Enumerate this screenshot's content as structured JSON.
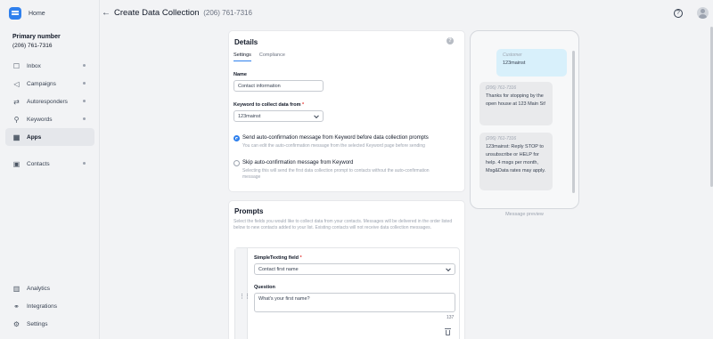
{
  "sidebar": {
    "home_label": "Home",
    "primary_title": "Primary number",
    "primary_number": "(206) 761-7316",
    "items": [
      {
        "label": "Inbox",
        "icon": "inbox-icon"
      },
      {
        "label": "Campaigns",
        "icon": "megaphone-icon"
      },
      {
        "label": "Autoresponders",
        "icon": "autoresponder-icon"
      },
      {
        "label": "Keywords",
        "icon": "key-icon"
      },
      {
        "label": "Apps",
        "icon": "apps-icon"
      },
      {
        "label": "Contacts",
        "icon": "contacts-icon"
      }
    ],
    "bottom": [
      {
        "label": "Analytics",
        "icon": "analytics-icon"
      },
      {
        "label": "Integrations",
        "icon": "integrations-icon"
      },
      {
        "label": "Settings",
        "icon": "gear-icon"
      }
    ]
  },
  "header": {
    "title": "Create Data Collection",
    "phone": "(206) 761-7316"
  },
  "details": {
    "title": "Details",
    "info": "?",
    "tabs": [
      "Settings",
      "Compliance"
    ],
    "name_label": "Name",
    "name_value": "Contact information",
    "keyword_label": "Keyword to collect data from",
    "keyword_value": "123mainst",
    "option1_title": "Send auto-confirmation message from Keyword before data collection prompts",
    "option1_sub": "You can edit the auto-confirmation message from the selected Keyword page before sending",
    "option2_title": "Skip auto-confirmation message from Keyword",
    "option2_sub": "Selecting this will send the first data collection prompt to contacts without the auto-confirmation message"
  },
  "prompts": {
    "title": "Prompts",
    "description": "Select the fields you would like to collect data from your contacts. Messages will be delivered in the order listed below to new contacts added to your list. Existing contacts will not receive data collection messages.",
    "field_label": "SimpleTexting field",
    "field_value": "Contact first name",
    "question_label": "Question",
    "question_value": "What's your first name?",
    "counter": "137"
  },
  "preview": {
    "out_who": "Customer",
    "out_text": "123mainst",
    "msg1_who": "(206) 761-7316",
    "msg1_text": "Thanks for stopping by the open house at 123 Main St!",
    "msg2_who": "(206) 761-7316",
    "msg2_text": "123mainst: Reply STOP to unsubscribe or HELP for help. 4 msgs per month, Msg&Data rates may apply.",
    "caption": "Message preview"
  },
  "colors": {
    "accent": "#2f80ed",
    "required": "#e53935",
    "outgoing_bubble": "#d8f0fb"
  }
}
